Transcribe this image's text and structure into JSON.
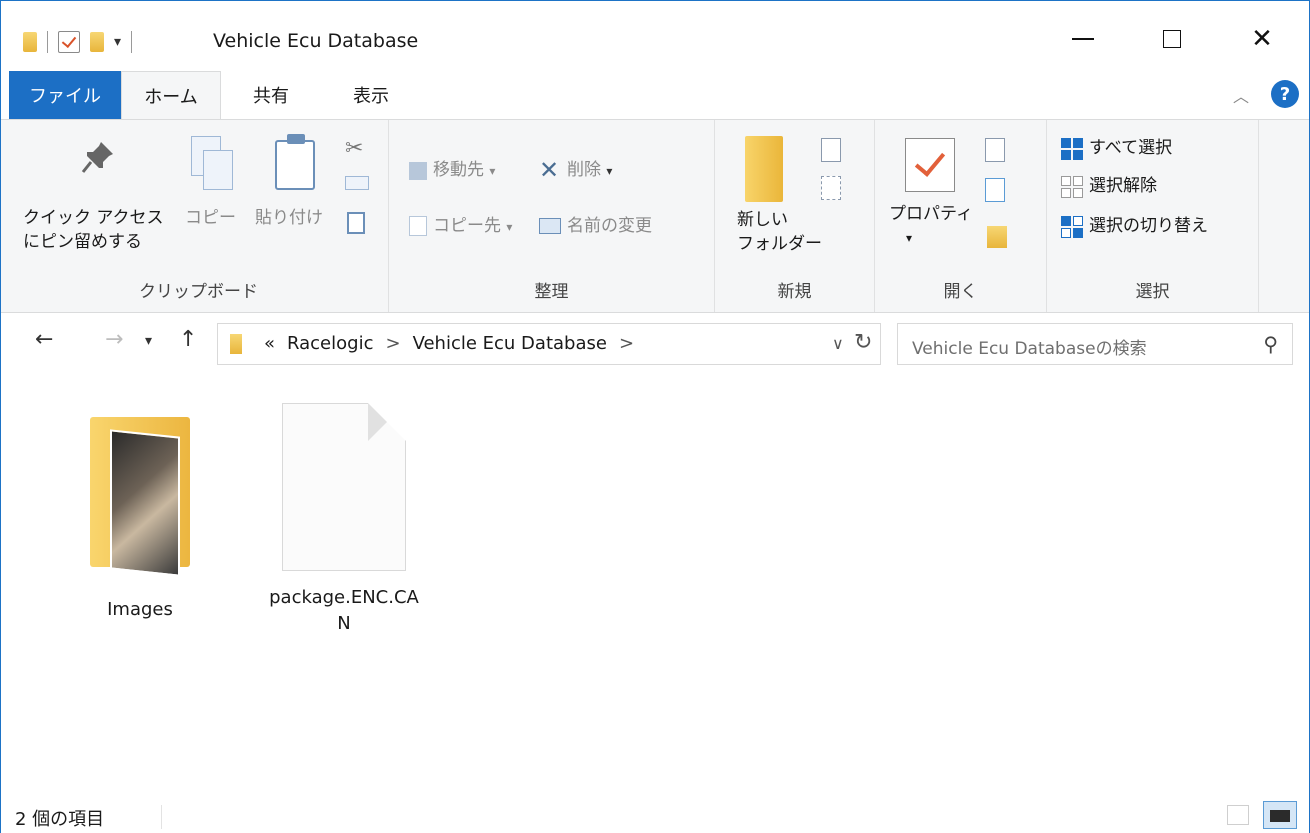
{
  "window": {
    "title": "Vehicle Ecu Database",
    "controls": {
      "minimize": "—",
      "maximize": "☐",
      "close": "✕"
    }
  },
  "tabs": {
    "file": "ファイル",
    "home": "ホーム",
    "share": "共有",
    "view": "表示"
  },
  "ribbon": {
    "clipboard": {
      "pin_line1": "クイック アクセス",
      "pin_line2": "にピン留めする",
      "copy": "コピー",
      "paste": "貼り付け",
      "label": "クリップボード"
    },
    "organize": {
      "move_to": "移動先",
      "copy_to": "コピー先",
      "delete": "削除",
      "rename": "名前の変更",
      "label": "整理"
    },
    "new": {
      "new_folder_line1": "新しい",
      "new_folder_line2": "フォルダー",
      "label": "新規"
    },
    "open": {
      "properties": "プロパティ",
      "label": "開く"
    },
    "select": {
      "select_all": "すべて選択",
      "select_none": "選択解除",
      "invert": "選択の切り替え",
      "label": "選択"
    }
  },
  "address": {
    "overflow": "«",
    "crumbs": [
      "Racelogic",
      "Vehicle Ecu Database"
    ],
    "sep": ">"
  },
  "search": {
    "placeholder": "Vehicle Ecu Databaseの検索"
  },
  "items": [
    {
      "name": "Images",
      "type": "folder"
    },
    {
      "name": "package.ENC.CAN",
      "type": "file"
    }
  ],
  "status": {
    "count": "2 個の項目"
  },
  "colors": {
    "accent": "#1c6fc5",
    "folder": "#eab63a"
  }
}
